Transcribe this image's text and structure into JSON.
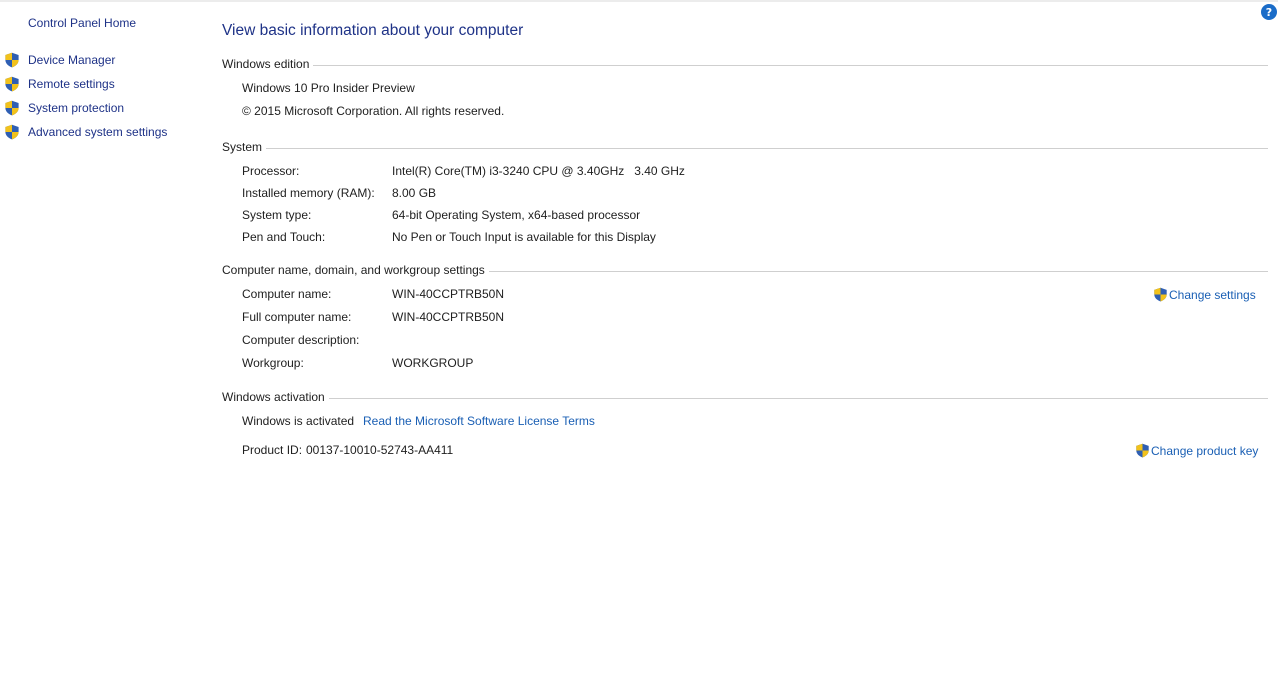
{
  "sidebar": {
    "home": "Control Panel Home",
    "items": [
      {
        "label": "Device Manager",
        "icon": "uac-shield-icon"
      },
      {
        "label": "Remote settings",
        "icon": "uac-shield-icon"
      },
      {
        "label": "System protection",
        "icon": "uac-shield-icon"
      },
      {
        "label": "Advanced system settings",
        "icon": "uac-shield-icon"
      }
    ]
  },
  "help": "?",
  "title": "View basic information about your computer",
  "edition": {
    "header": "Windows edition",
    "name": "Windows 10 Pro Insider Preview",
    "copyright": "© 2015 Microsoft Corporation. All rights reserved."
  },
  "system": {
    "header": "System",
    "rows": [
      {
        "label": "Processor:",
        "value": "Intel(R) Core(TM) i3-3240 CPU @ 3.40GHz   3.40 GHz"
      },
      {
        "label": "Installed memory (RAM):",
        "value": "8.00 GB"
      },
      {
        "label": "System type:",
        "value": "64-bit Operating System, x64-based processor"
      },
      {
        "label": "Pen and Touch:",
        "value": "No Pen or Touch Input is available for this Display"
      }
    ]
  },
  "computer": {
    "header": "Computer name, domain, and workgroup settings",
    "rows": [
      {
        "label": "Computer name:",
        "value": "WIN-40CCPTRB50N"
      },
      {
        "label": "Full computer name:",
        "value": "WIN-40CCPTRB50N"
      },
      {
        "label": "Computer description:",
        "value": ""
      },
      {
        "label": "Workgroup:",
        "value": "WORKGROUP"
      }
    ],
    "change_link": "Change settings"
  },
  "activation": {
    "header": "Windows activation",
    "status": "Windows is activated",
    "license_link": "Read the Microsoft Software License Terms",
    "product_id_label": "Product ID:",
    "product_id": "00137-10010-52743-AA411",
    "change_key_link": "Change product key"
  },
  "colors": {
    "link": "#1a5fb4",
    "nav_link": "#1e3287",
    "title": "#1e3287",
    "shield_blue": "#2f5fb3",
    "shield_yellow": "#f2c21b"
  }
}
